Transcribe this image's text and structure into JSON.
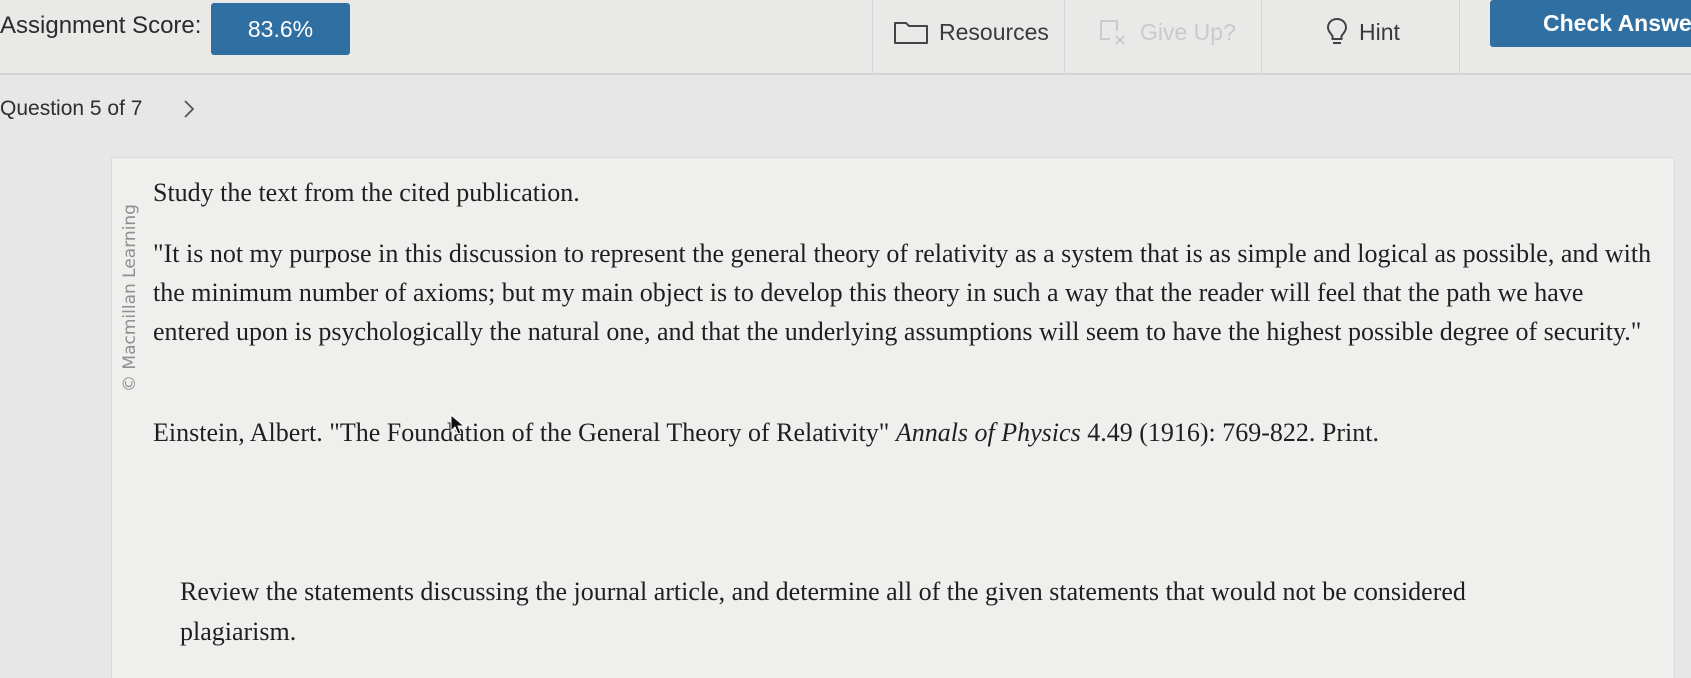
{
  "header": {
    "score_label": "Assignment Score:",
    "score_value": "83.6%",
    "resources_label": "Resources",
    "give_up_label": "Give Up?",
    "hint_label": "Hint",
    "check_answer_label": "Check Answer"
  },
  "nav": {
    "question_label": "Question 5 of 7"
  },
  "content": {
    "watermark": "© Macmillan Learning",
    "intro": "Study the text from the cited publication.",
    "quote": "\"It is not my purpose in this discussion to represent the general theory of relativity as a system that is as simple and logical as possible, and with the minimum number of axioms; but my main object is to develop this theory in such a way that the reader will feel that the path we have entered upon is psychologically the natural one, and that the underlying assumptions will seem to have the highest possible degree of security.\"",
    "citation": {
      "author": "Einstein, Albert.",
      "title": "\"The Foundation of the General Theory of Relativity\"",
      "journal": "Annals of Physics",
      "details": "4.49 (1916): 769-822. Print."
    },
    "review": "Review the statements discussing the journal article, and determine all of the given statements that would not be considered plagiarism."
  },
  "colors": {
    "accent": "#2f6fa1",
    "disabled": "#c9cacb"
  },
  "icons": {
    "resources": "folder-icon",
    "give_up": "give-up-icon",
    "hint": "lightbulb-icon",
    "next": "chevron-right-icon"
  }
}
